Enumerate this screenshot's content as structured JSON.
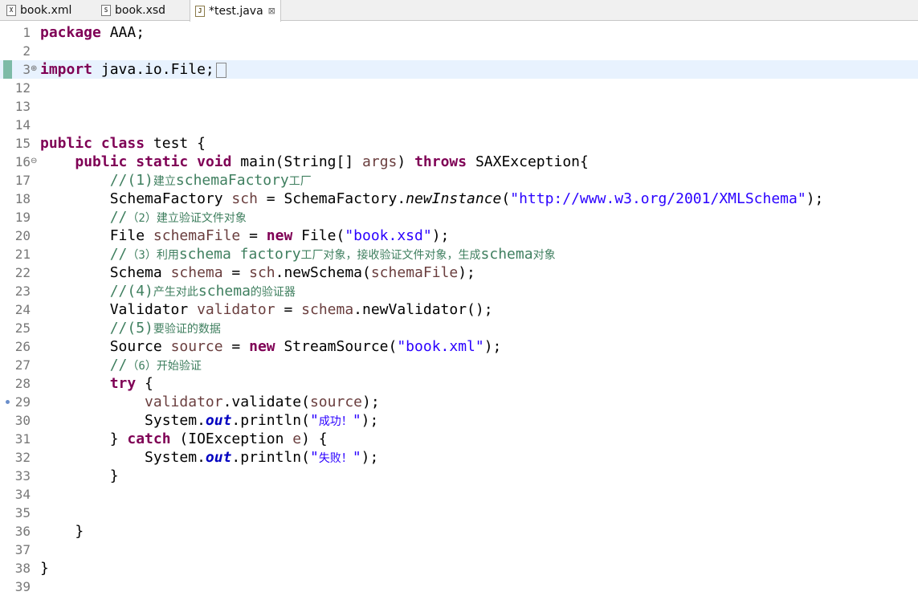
{
  "tabs": [
    {
      "label": "book.xml",
      "icon": "xml-file-icon"
    },
    {
      "label": "book.xsd",
      "icon": "xsd-file-icon"
    },
    {
      "label": "*test.java",
      "icon": "java-file-icon",
      "active": true
    }
  ],
  "editor": {
    "lines": [
      {
        "n": "1",
        "tokens": [
          {
            "t": "package",
            "c": "kw"
          },
          {
            "t": " AAA;"
          }
        ]
      },
      {
        "n": "2",
        "tokens": []
      },
      {
        "n": "3",
        "fold": "plus",
        "current": true,
        "marker": true,
        "caret": true,
        "tokens": [
          {
            "t": "import",
            "c": "kw"
          },
          {
            "t": " java.io.File;"
          }
        ]
      },
      {
        "n": "12",
        "tokens": []
      },
      {
        "n": "13",
        "tokens": []
      },
      {
        "n": "14",
        "tokens": []
      },
      {
        "n": "15",
        "tokens": [
          {
            "t": "public",
            "c": "kw"
          },
          {
            "t": " "
          },
          {
            "t": "class",
            "c": "kw"
          },
          {
            "t": " test {"
          }
        ]
      },
      {
        "n": "16",
        "fold": "minus",
        "tokens": [
          {
            "t": "    "
          },
          {
            "t": "public",
            "c": "kw"
          },
          {
            "t": " "
          },
          {
            "t": "static",
            "c": "kw"
          },
          {
            "t": " "
          },
          {
            "t": "void",
            "c": "kw"
          },
          {
            "t": " main(String[] "
          },
          {
            "t": "args",
            "c": "var"
          },
          {
            "t": ") "
          },
          {
            "t": "throws",
            "c": "kw"
          },
          {
            "t": " SAXException{"
          }
        ]
      },
      {
        "n": "17",
        "tokens": [
          {
            "t": "        "
          },
          {
            "t": "//(1)",
            "c": "cmt"
          },
          {
            "t": "建立",
            "c": "cmt cjk"
          },
          {
            "t": "schemaFactory",
            "c": "cmt"
          },
          {
            "t": "工厂",
            "c": "cmt cjk"
          }
        ]
      },
      {
        "n": "18",
        "tokens": [
          {
            "t": "        SchemaFactory "
          },
          {
            "t": "sch",
            "c": "var"
          },
          {
            "t": " = SchemaFactory."
          },
          {
            "t": "newInstance",
            "c": "ital"
          },
          {
            "t": "("
          },
          {
            "t": "\"http://www.w3.org/2001/XMLSchema\"",
            "c": "str"
          },
          {
            "t": ");"
          }
        ]
      },
      {
        "n": "19",
        "tokens": [
          {
            "t": "        "
          },
          {
            "t": "//",
            "c": "cmt"
          },
          {
            "t": "（2）建立验证文件对象",
            "c": "cmt cjk"
          }
        ]
      },
      {
        "n": "20",
        "tokens": [
          {
            "t": "        File "
          },
          {
            "t": "schemaFile",
            "c": "var"
          },
          {
            "t": " = "
          },
          {
            "t": "new",
            "c": "kw"
          },
          {
            "t": " File("
          },
          {
            "t": "\"book.xsd\"",
            "c": "str"
          },
          {
            "t": ");"
          }
        ]
      },
      {
        "n": "21",
        "tokens": [
          {
            "t": "        "
          },
          {
            "t": "//",
            "c": "cmt"
          },
          {
            "t": "（3）利用",
            "c": "cmt cjk"
          },
          {
            "t": "schema factory",
            "c": "cmt"
          },
          {
            "t": "工厂对象，接收验证文件对象，生成",
            "c": "cmt cjk"
          },
          {
            "t": "schema",
            "c": "cmt"
          },
          {
            "t": "对象",
            "c": "cmt cjk"
          }
        ]
      },
      {
        "n": "22",
        "tokens": [
          {
            "t": "        Schema "
          },
          {
            "t": "schema",
            "c": "var"
          },
          {
            "t": " = "
          },
          {
            "t": "sch",
            "c": "var"
          },
          {
            "t": ".newSchema("
          },
          {
            "t": "schemaFile",
            "c": "var"
          },
          {
            "t": ");"
          }
        ]
      },
      {
        "n": "23",
        "tokens": [
          {
            "t": "        "
          },
          {
            "t": "//(4)",
            "c": "cmt"
          },
          {
            "t": "产生对此",
            "c": "cmt cjk"
          },
          {
            "t": "schema",
            "c": "cmt"
          },
          {
            "t": "的验证器",
            "c": "cmt cjk"
          }
        ]
      },
      {
        "n": "24",
        "tokens": [
          {
            "t": "        Validator "
          },
          {
            "t": "validator",
            "c": "var"
          },
          {
            "t": " = "
          },
          {
            "t": "schema",
            "c": "var"
          },
          {
            "t": ".newValidator();"
          }
        ]
      },
      {
        "n": "25",
        "tokens": [
          {
            "t": "        "
          },
          {
            "t": "//(5)",
            "c": "cmt"
          },
          {
            "t": "要验证的数据",
            "c": "cmt cjk"
          }
        ]
      },
      {
        "n": "26",
        "tokens": [
          {
            "t": "        Source "
          },
          {
            "t": "source",
            "c": "var"
          },
          {
            "t": " = "
          },
          {
            "t": "new",
            "c": "kw"
          },
          {
            "t": " StreamSource("
          },
          {
            "t": "\"book.xml\"",
            "c": "str"
          },
          {
            "t": ");"
          }
        ]
      },
      {
        "n": "27",
        "tokens": [
          {
            "t": "        "
          },
          {
            "t": "//",
            "c": "cmt"
          },
          {
            "t": "（6）开始验证",
            "c": "cmt cjk"
          }
        ]
      },
      {
        "n": "28",
        "tokens": [
          {
            "t": "        "
          },
          {
            "t": "try",
            "c": "kw"
          },
          {
            "t": " {"
          }
        ]
      },
      {
        "n": "29",
        "dot": true,
        "tokens": [
          {
            "t": "            "
          },
          {
            "t": "validator",
            "c": "var"
          },
          {
            "t": ".validate("
          },
          {
            "t": "source",
            "c": "var"
          },
          {
            "t": ");"
          }
        ]
      },
      {
        "n": "30",
        "tokens": [
          {
            "t": "            System."
          },
          {
            "t": "out",
            "c": "fld"
          },
          {
            "t": ".println("
          },
          {
            "t": "\"",
            "c": "str"
          },
          {
            "t": "成功！",
            "c": "str cjk"
          },
          {
            "t": "\"",
            "c": "str"
          },
          {
            "t": ");"
          }
        ]
      },
      {
        "n": "31",
        "tokens": [
          {
            "t": "        } "
          },
          {
            "t": "catch",
            "c": "kw"
          },
          {
            "t": " (IOException "
          },
          {
            "t": "e",
            "c": "var"
          },
          {
            "t": ") {"
          }
        ]
      },
      {
        "n": "32",
        "tokens": [
          {
            "t": "            System."
          },
          {
            "t": "out",
            "c": "fld"
          },
          {
            "t": ".println("
          },
          {
            "t": "\"",
            "c": "str"
          },
          {
            "t": "失败！",
            "c": "str cjk"
          },
          {
            "t": "\"",
            "c": "str"
          },
          {
            "t": ");"
          }
        ]
      },
      {
        "n": "33",
        "tokens": [
          {
            "t": "        }"
          }
        ]
      },
      {
        "n": "34",
        "tokens": []
      },
      {
        "n": "35",
        "tokens": []
      },
      {
        "n": "36",
        "tokens": [
          {
            "t": "    }"
          }
        ]
      },
      {
        "n": "37",
        "tokens": []
      },
      {
        "n": "38",
        "tokens": [
          {
            "t": "}"
          }
        ]
      },
      {
        "n": "39",
        "tokens": []
      }
    ]
  }
}
